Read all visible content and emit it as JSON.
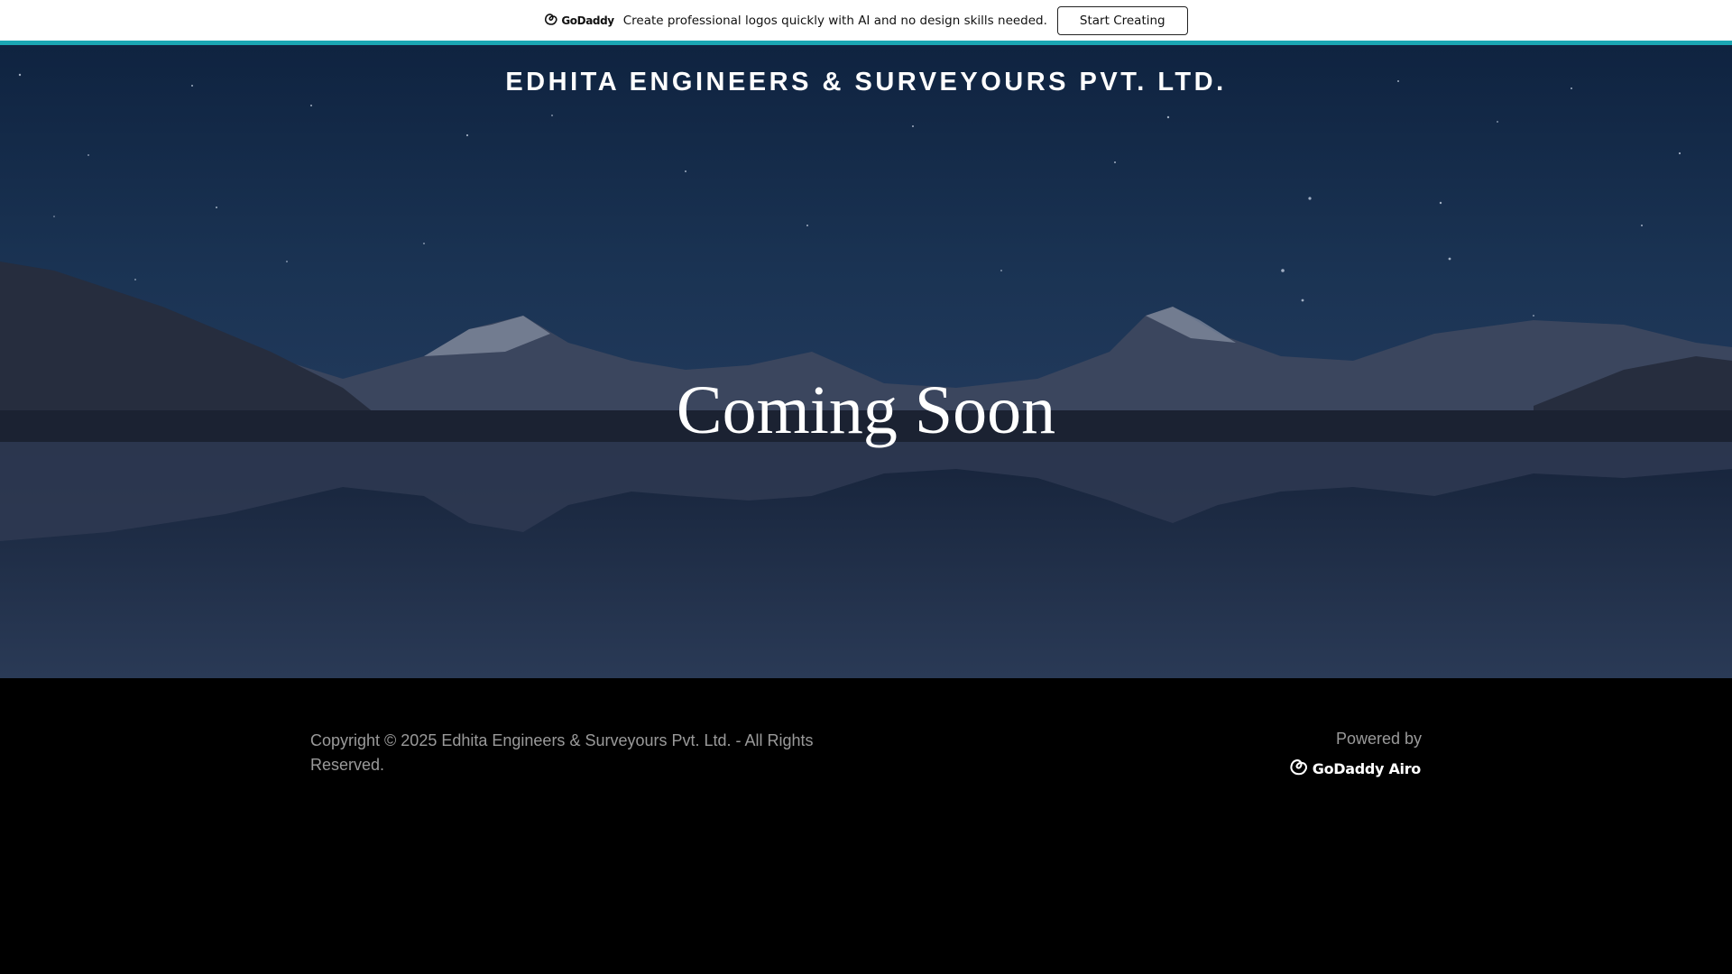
{
  "promo": {
    "brand": "GoDaddy",
    "message": "Create professional logos quickly with AI and no design skills needed.",
    "cta_label": "Start Creating",
    "accent_color": "#1ba6b3"
  },
  "hero": {
    "site_title": "EDHITA ENGINEERS & SURVEYOURS PVT. LTD.",
    "headline": "Coming Soon",
    "background": "night-mountain-lake-image"
  },
  "footer": {
    "copyright": "Copyright © 2025 Edhita Engineers & Surveyours Pvt. Ltd. - All Rights Reserved.",
    "powered_by": "Powered by",
    "powered_logo": "GoDaddy Airo"
  },
  "icons": {
    "brand_logo": "godaddy-logo-icon"
  }
}
